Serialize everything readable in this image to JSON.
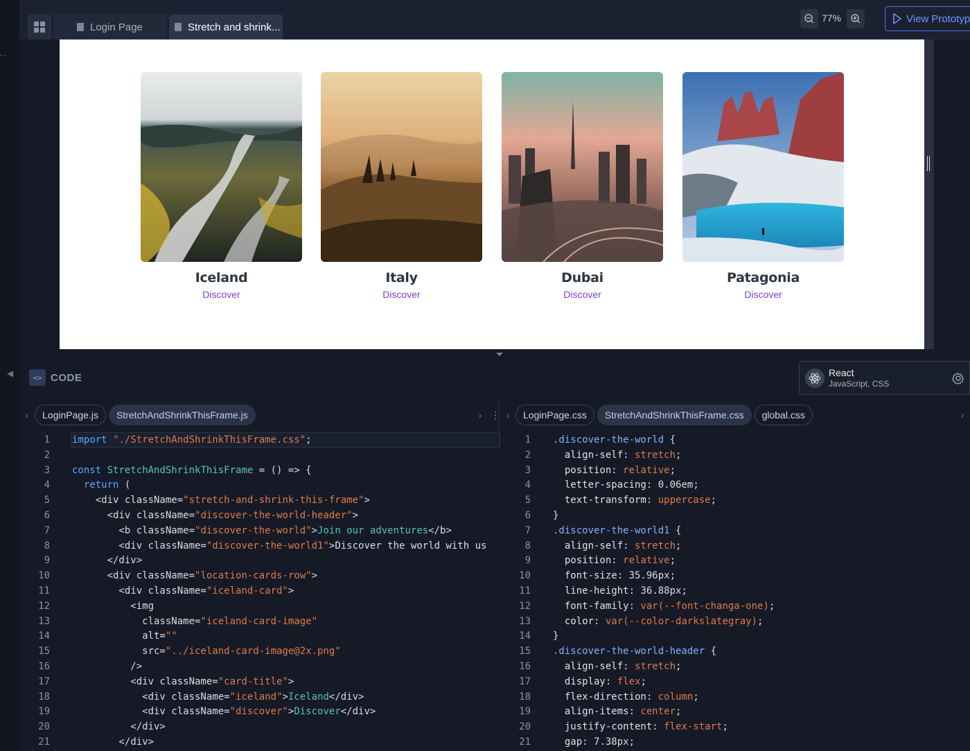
{
  "topbar": {
    "tabs": [
      {
        "label": "Login Page"
      },
      {
        "label": "Stretch and shrink..."
      }
    ],
    "zoom": "77%",
    "view_prototype": "View Prototype"
  },
  "preview": {
    "cards": [
      {
        "title": "Iceland",
        "link": "Discover"
      },
      {
        "title": "Italy",
        "link": "Discover"
      },
      {
        "title": "Dubai",
        "link": "Discover"
      },
      {
        "title": "Patagonia",
        "link": "Discover"
      }
    ]
  },
  "code_panel": {
    "label": "CODE",
    "framework": {
      "title": "React",
      "subtitle": "JavaScript, CSS"
    },
    "js_tabs": [
      "LoginPage.js",
      "StretchAndShrinkThisFrame.js"
    ],
    "css_tabs": [
      "LoginPage.css",
      "StretchAndShrinkThisFrame.css",
      "global.css"
    ]
  },
  "js_lines": [
    "import \"./StretchAndShrinkThisFrame.css\";",
    "",
    "const StretchAndShrinkThisFrame = () => {",
    "  return (",
    "    <div className=\"stretch-and-shrink-this-frame\">",
    "      <div className=\"discover-the-world-header\">",
    "        <b className=\"discover-the-world\">Join our adventures</b>",
    "        <div className=\"discover-the-world1\">Discover the world with us",
    "      </div>",
    "      <div className=\"location-cards-row\">",
    "        <div className=\"iceland-card\">",
    "          <img",
    "            className=\"iceland-card-image\"",
    "            alt=\"\"",
    "            src=\"../iceland-card-image@2x.png\"",
    "          />",
    "          <div className=\"card-title\">",
    "            <div className=\"iceland\">Iceland</div>",
    "            <div className=\"discover\">Discover</div>",
    "          </div>",
    "        </div>"
  ],
  "css_lines": [
    ".discover-the-world {",
    "  align-self: stretch;",
    "  position: relative;",
    "  letter-spacing: 0.06em;",
    "  text-transform: uppercase;",
    "}",
    ".discover-the-world1 {",
    "  align-self: stretch;",
    "  position: relative;",
    "  font-size: 35.96px;",
    "  line-height: 36.88px;",
    "  font-family: var(--font-changa-one);",
    "  color: var(--color-darkslategray);",
    "}",
    ".discover-the-world-header {",
    "  align-self: stretch;",
    "  display: flex;",
    "  flex-direction: column;",
    "  align-items: center;",
    "  justify-content: flex-start;",
    "  gap: 7.38px;"
  ],
  "line_numbers": [
    "1",
    "2",
    "3",
    "4",
    "5",
    "6",
    "7",
    "8",
    "9",
    "10",
    "11",
    "12",
    "13",
    "14",
    "15",
    "16",
    "17",
    "18",
    "19",
    "20",
    "21"
  ]
}
